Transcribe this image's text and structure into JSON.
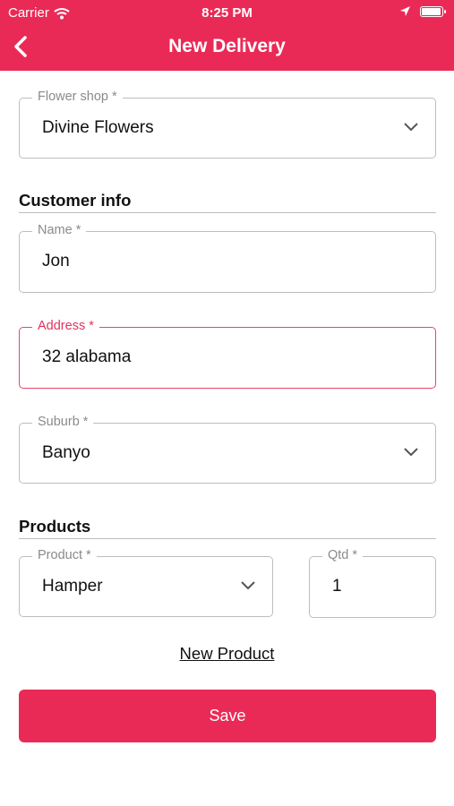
{
  "status_bar": {
    "carrier": "Carrier",
    "time": "8:25 PM",
    "battery_level": 1.0
  },
  "header": {
    "title": "New Delivery",
    "back_icon": "chevron-left-icon"
  },
  "fields": {
    "flower_shop": {
      "label": "Flower shop *",
      "value": "Divine Flowers"
    },
    "name": {
      "label": "Name *",
      "value": "Jon"
    },
    "address": {
      "label": "Address *",
      "value": "32 alabama"
    },
    "suburb": {
      "label": "Suburb *",
      "value": "Banyo"
    },
    "product": {
      "label": "Product *",
      "value": "Hamper"
    },
    "qty": {
      "label": "Qtd *",
      "value": "1"
    }
  },
  "sections": {
    "customer_info": "Customer info",
    "products": "Products"
  },
  "actions": {
    "new_product": "New Product",
    "save": "Save"
  },
  "colors": {
    "accent": "#ea2a56",
    "border": "#bdbdbd"
  }
}
